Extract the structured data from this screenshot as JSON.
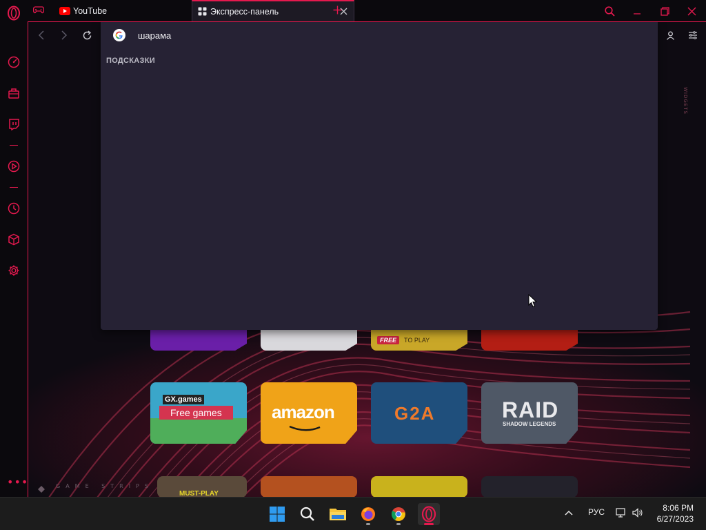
{
  "colors": {
    "accent": "#e5194e",
    "dropdown_bg": "#262234",
    "sidebar_bg": "#0b090d",
    "taskbar_bg": "#1c1c1c"
  },
  "sidebar": {
    "items": [
      {
        "name": "speed-dial-icon"
      },
      {
        "name": "gx-control-icon"
      },
      {
        "name": "twitch-icon"
      },
      {
        "name": "player-icon"
      },
      {
        "name": "history-icon"
      },
      {
        "name": "extensions-icon"
      },
      {
        "name": "settings-icon"
      }
    ],
    "more": "•••"
  },
  "tabs": [
    {
      "title": "",
      "icon": "gamepad-icon"
    },
    {
      "title": "YouTube",
      "icon": "youtube-icon"
    },
    {
      "title": "Экспресс-панель",
      "icon": "grid-icon",
      "active": true
    }
  ],
  "toolbar": {
    "back": "back-icon",
    "forward": "forward-icon",
    "reload": "reload-icon"
  },
  "search": {
    "engine_icon": "google-icon",
    "value": "шарама"
  },
  "suggestions": {
    "label": "ПОДСКАЗКИ"
  },
  "widgets_label": "WIDGETS",
  "speed_dial": {
    "tiles_row2": [
      {
        "label": "GX.games",
        "sublabel": "Free games"
      },
      {
        "label": "amazon"
      },
      {
        "label": "G2A"
      },
      {
        "label": "RAID",
        "sublabel": "SHADOW LEGENDS"
      }
    ],
    "tiles_row1_partial": [
      {
        "label": ""
      },
      {
        "label": ""
      },
      {
        "label": "FREE",
        "sublabel": "TO PLAY"
      },
      {
        "label": ""
      }
    ],
    "tiles_row3_partial": [
      {
        "label": "MUST-PLAY"
      },
      {
        "label": ""
      },
      {
        "label": ""
      },
      {
        "label": ""
      }
    ]
  },
  "game_strips_label": "GAME STRIPS",
  "taskbar": {
    "apps": [
      "start-icon",
      "search-icon",
      "file-explorer-icon",
      "firefox-icon",
      "chrome-icon",
      "opera-gx-icon"
    ],
    "tray_chevron": "^",
    "language": "РУС",
    "time": "8:06 PM",
    "date": "6/27/2023"
  }
}
